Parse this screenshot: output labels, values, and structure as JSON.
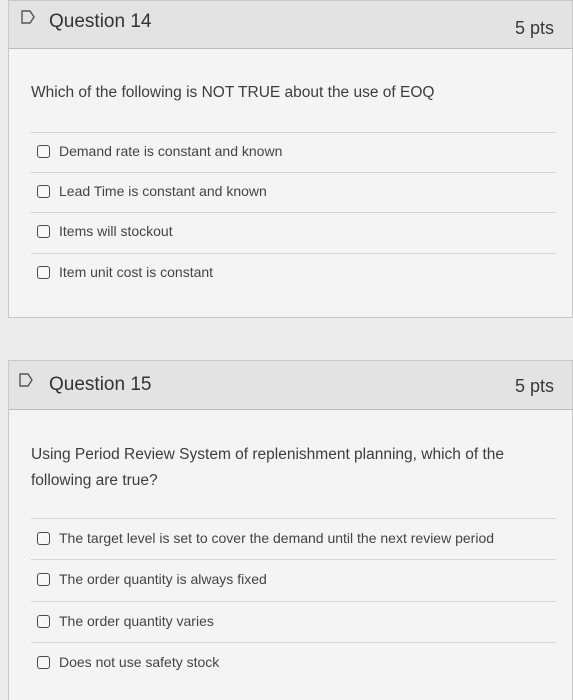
{
  "questions": [
    {
      "title": "Question 14",
      "points": "5 pts",
      "prompt": "Which of the following is NOT TRUE about the use of EOQ",
      "options": [
        "Demand rate is constant and known",
        "Lead Time is constant and known",
        "Items will stockout",
        "Item unit cost is constant"
      ]
    },
    {
      "title": "Question 15",
      "points": "5 pts",
      "prompt": "Using Period Review System of replenishment planning, which of the following are true?",
      "options": [
        "The target level is set to cover the demand until the next review period",
        "The order quantity is always fixed",
        "The order quantity varies",
        "Does not use safety stock"
      ]
    }
  ],
  "icons": {
    "flag": "bookmark-flag-icon",
    "radio": "radio-button-icon"
  },
  "colors": {
    "header_bg": "#e3e3e3",
    "body_bg": "#f4f4f4",
    "text": "#3b3b3b"
  }
}
